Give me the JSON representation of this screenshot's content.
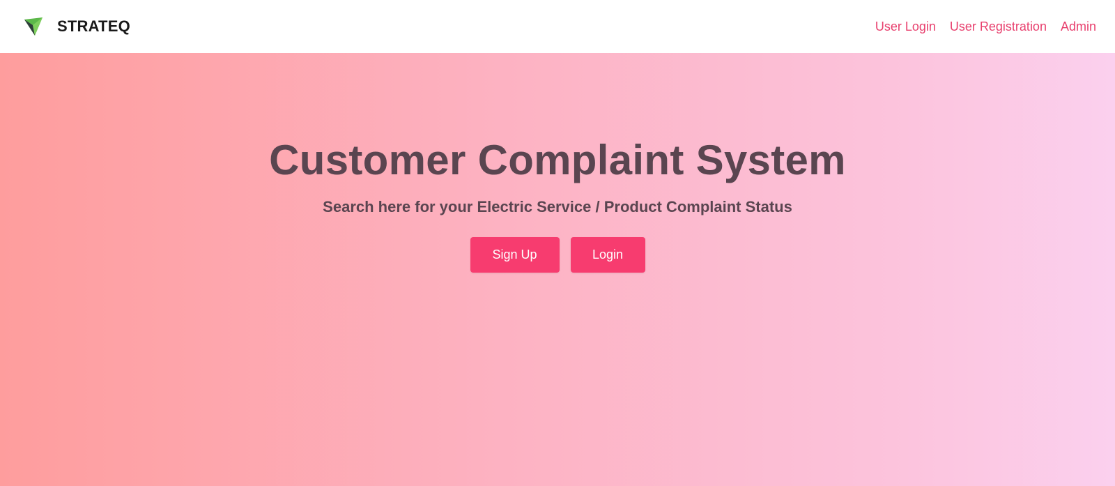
{
  "brand": {
    "name": "STRATEQ",
    "logo_icon": "paper-plane-logo-icon"
  },
  "nav": {
    "links": [
      {
        "label": "User Login"
      },
      {
        "label": "User Registration"
      },
      {
        "label": "Admin"
      }
    ]
  },
  "hero": {
    "title": "Customer Complaint System",
    "subtitle": "Search here for your Electric Service / Product Complaint Status",
    "signup_label": "Sign Up",
    "login_label": "Login"
  },
  "colors": {
    "accent": "#f73c6f",
    "nav_link": "#e8406e",
    "heading_text": "#5a4550",
    "gradient_start": "#fe9d9d",
    "gradient_end": "#fbd0ee"
  }
}
